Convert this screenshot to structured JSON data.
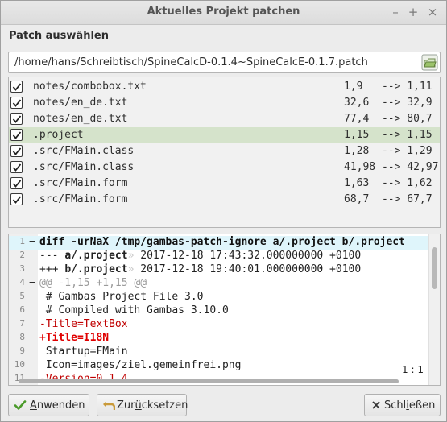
{
  "window": {
    "title": "Aktuelles Projekt patchen",
    "controls": [
      "minimize-icon",
      "maximize-icon",
      "close-icon"
    ]
  },
  "heading": "Patch auswählen",
  "patch_path": "/home/hans/Schreibtisch/SpineCalcD-0.1.4~SpineCalcE-0.1.7.patch",
  "files": [
    {
      "name": "notes/combobox.txt",
      "from": "1,9",
      "arrow": "-->",
      "to": "1,11",
      "checked": true,
      "selected": false
    },
    {
      "name": "notes/en_de.txt",
      "from": "32,6",
      "arrow": "-->",
      "to": "32,9",
      "checked": true,
      "selected": false
    },
    {
      "name": "notes/en_de.txt",
      "from": "77,4",
      "arrow": "-->",
      "to": "80,7",
      "checked": true,
      "selected": false
    },
    {
      "name": ".project",
      "from": "1,15",
      "arrow": "-->",
      "to": "1,15",
      "checked": true,
      "selected": true
    },
    {
      "name": ".src/FMain.class",
      "from": "1,28",
      "arrow": "-->",
      "to": "1,29",
      "checked": true,
      "selected": false
    },
    {
      "name": ".src/FMain.class",
      "from": "41,98",
      "arrow": "-->",
      "to": "42,97",
      "checked": true,
      "selected": false
    },
    {
      "name": ".src/FMain.form",
      "from": "1,63",
      "arrow": "-->",
      "to": "1,62",
      "checked": true,
      "selected": false
    },
    {
      "name": ".src/FMain.form",
      "from": "68,7",
      "arrow": "-->",
      "to": "67,7",
      "checked": true,
      "selected": false
    }
  ],
  "diff": {
    "lines": [
      {
        "num": "1",
        "fold": "−",
        "kind": "header",
        "text": "diff -urNaX /tmp/gambas-patch-ignore a/.project b/.project"
      },
      {
        "num": "2",
        "fold": "",
        "kind": "meta",
        "prefix": "--- ",
        "file": "a/.project",
        "mark": "»",
        "text": " 2017-12-18 17:43:32.000000000 +0100"
      },
      {
        "num": "3",
        "fold": "",
        "kind": "meta",
        "prefix": "+++ ",
        "file": "b/.project",
        "mark": "»",
        "text": " 2017-12-18 19:40:01.000000000 +0100"
      },
      {
        "num": "4",
        "fold": "−",
        "kind": "hunk",
        "text": "@@ -1,15 +1,15 @@"
      },
      {
        "num": "5",
        "fold": "",
        "kind": "ctx",
        "text": " # Gambas Project File 3.0"
      },
      {
        "num": "6",
        "fold": "",
        "kind": "ctx",
        "text": " # Compiled with Gambas 3.10.0"
      },
      {
        "num": "7",
        "fold": "",
        "kind": "del",
        "text": "-Title=TextBox"
      },
      {
        "num": "8",
        "fold": "",
        "kind": "add",
        "text": "+Title=I18N"
      },
      {
        "num": "9",
        "fold": "",
        "kind": "ctx",
        "text": " Startup=FMain"
      },
      {
        "num": "10",
        "fold": "",
        "kind": "ctx",
        "text": " Icon=images/ziel.gemeinfrei.png"
      },
      {
        "num": "11",
        "fold": "",
        "kind": "del",
        "text": "-Version=0.1.4"
      }
    ],
    "cursor_position": "1 : 1"
  },
  "buttons": {
    "apply": {
      "pre": "",
      "mnemonic": "A",
      "post": "nwenden"
    },
    "reset": {
      "pre": "Zur",
      "mnemonic": "ü",
      "post": "cksetzen"
    },
    "close": {
      "pre": "Schl",
      "mnemonic": "i",
      "post": "eßen"
    }
  },
  "colors": {
    "selected_row": "#d5e3cb",
    "diff_header_highlight": "#dff5fb",
    "deleted_line": "#c00000",
    "added_line": "#e00000",
    "hunk_header": "#9a9a9a"
  }
}
